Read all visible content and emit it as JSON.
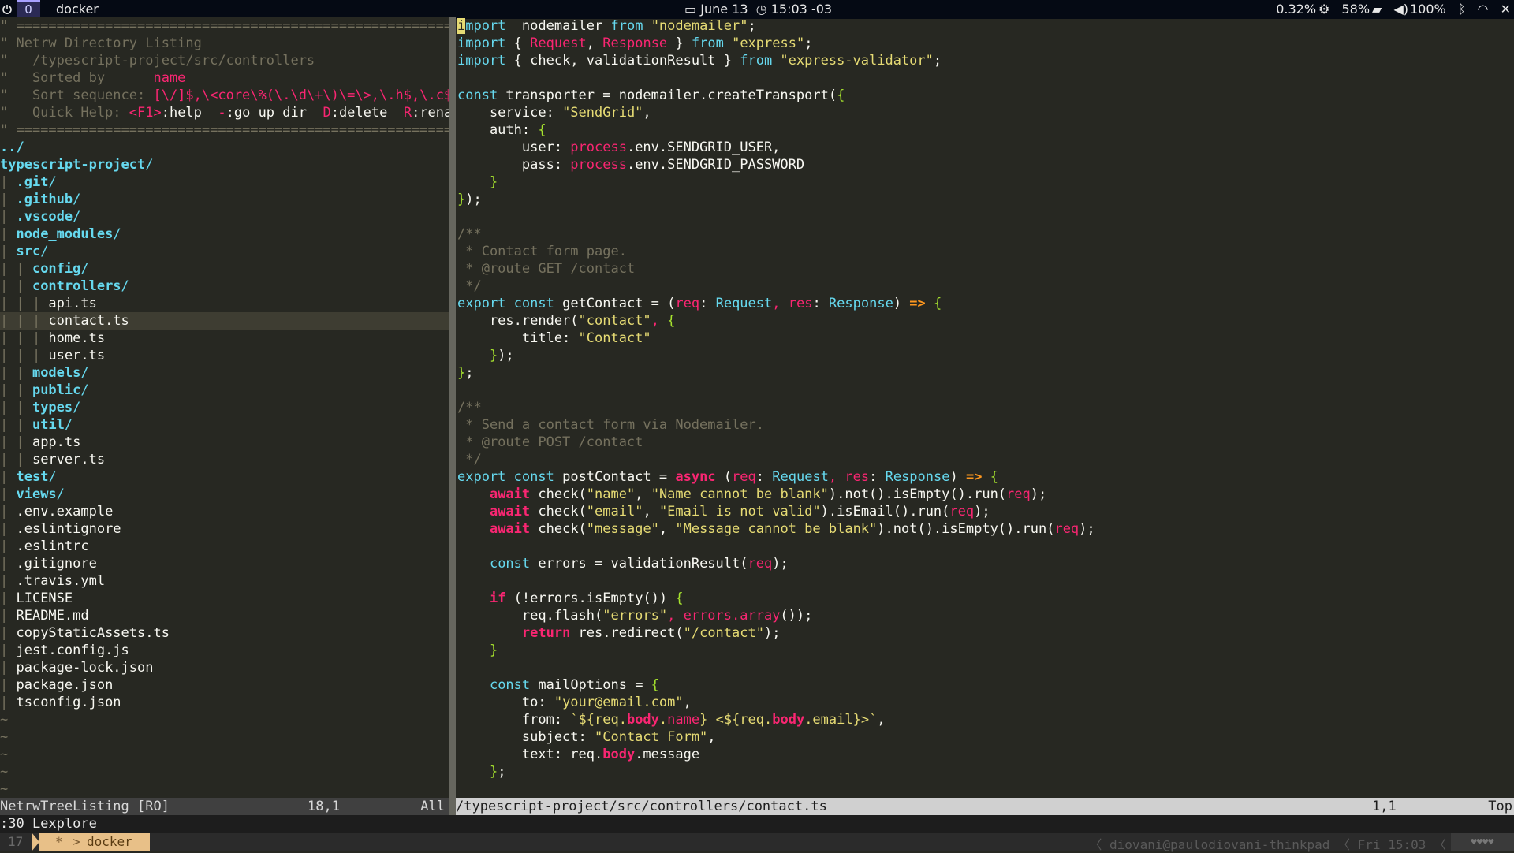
{
  "topbar": {
    "workspace": "0",
    "window_title": "docker",
    "date": "June 13",
    "time": "15:03 -03",
    "cpu": "0.32%",
    "memory": "58%",
    "volume": "100%",
    "icons": [
      "power-icon",
      "calendar-icon",
      "clock-icon",
      "cpu-icon",
      "memory-icon",
      "volume-icon",
      "bluetooth-icon",
      "wifi-icon",
      "bell-off-icon"
    ]
  },
  "netrw": {
    "header": [
      "\" ============================================================================",
      "\" Netrw Directory Listing",
      "\"   /typescript-project/src/controllers",
      "\"   Sorted by      ",
      "\"   Sort sequence: ",
      "\"   Quick Help: ",
      "\" ============================================================================"
    ],
    "sorted_by_value": "name",
    "sort_sequence_value": "[\\/]$,\\<core\\%(\\.\\d\\+\\)\\=\\>,\\.h$,\\.c$,",
    "quick_help_items": [
      "<F1>",
      ":help  ",
      "-",
      ":go up dir  ",
      "D",
      ":delete  ",
      "R",
      ":renam"
    ],
    "tree": [
      {
        "prefix": "",
        "name": "../",
        "dir": true
      },
      {
        "prefix": "",
        "name": "typescript-project",
        "dir": true
      },
      {
        "prefix": "| ",
        "name": ".git",
        "dir": true
      },
      {
        "prefix": "| ",
        "name": ".github",
        "dir": true
      },
      {
        "prefix": "| ",
        "name": ".vscode",
        "dir": true
      },
      {
        "prefix": "| ",
        "name": "node_modules",
        "dir": true
      },
      {
        "prefix": "| ",
        "name": "src",
        "dir": true
      },
      {
        "prefix": "| | ",
        "name": "config",
        "dir": true
      },
      {
        "prefix": "| | ",
        "name": "controllers",
        "dir": true
      },
      {
        "prefix": "| | | ",
        "name": "api.ts",
        "dir": false
      },
      {
        "prefix": "| | | ",
        "name": "contact.ts",
        "dir": false,
        "current": true
      },
      {
        "prefix": "| | | ",
        "name": "home.ts",
        "dir": false
      },
      {
        "prefix": "| | | ",
        "name": "user.ts",
        "dir": false
      },
      {
        "prefix": "| | ",
        "name": "models",
        "dir": true
      },
      {
        "prefix": "| | ",
        "name": "public",
        "dir": true
      },
      {
        "prefix": "| | ",
        "name": "types",
        "dir": true
      },
      {
        "prefix": "| | ",
        "name": "util",
        "dir": true
      },
      {
        "prefix": "| | ",
        "name": "app.ts",
        "dir": false
      },
      {
        "prefix": "| | ",
        "name": "server.ts",
        "dir": false
      },
      {
        "prefix": "| ",
        "name": "test",
        "dir": true
      },
      {
        "prefix": "| ",
        "name": "views",
        "dir": true
      },
      {
        "prefix": "| ",
        "name": ".env.example",
        "dir": false
      },
      {
        "prefix": "| ",
        "name": ".eslintignore",
        "dir": false
      },
      {
        "prefix": "| ",
        "name": ".eslintrc",
        "dir": false
      },
      {
        "prefix": "| ",
        "name": ".gitignore",
        "dir": false
      },
      {
        "prefix": "| ",
        "name": ".travis.yml",
        "dir": false
      },
      {
        "prefix": "| ",
        "name": "LICENSE",
        "dir": false
      },
      {
        "prefix": "| ",
        "name": "README.md",
        "dir": false
      },
      {
        "prefix": "| ",
        "name": "copyStaticAssets.ts",
        "dir": false
      },
      {
        "prefix": "| ",
        "name": "jest.config.js",
        "dir": false
      },
      {
        "prefix": "| ",
        "name": "package-lock.json",
        "dir": false
      },
      {
        "prefix": "| ",
        "name": "package.json",
        "dir": false
      },
      {
        "prefix": "| ",
        "name": "tsconfig.json",
        "dir": false
      }
    ],
    "tilde_lines": [
      "~",
      "~",
      "~",
      "~",
      "~"
    ]
  },
  "code": {
    "lines": [
      [
        [
          "cursor",
          "i"
        ],
        [
          "kw",
          "mport"
        ],
        [
          "",
          "  nodemailer "
        ],
        [
          "kw",
          "from"
        ],
        [
          "str",
          " \"nodemailer\""
        ],
        [
          "",
          ";"
        ]
      ],
      [
        [
          "kw",
          "import"
        ],
        [
          "",
          " { "
        ],
        [
          "red",
          "Request"
        ],
        [
          "",
          ", "
        ],
        [
          "red",
          "Response"
        ],
        [
          "",
          " } "
        ],
        [
          "kw",
          "from"
        ],
        [
          "str",
          " \"express\""
        ],
        [
          "",
          ";"
        ]
      ],
      [
        [
          "kw",
          "import"
        ],
        [
          "",
          " { check, validationResult } "
        ],
        [
          "kw",
          "from"
        ],
        [
          "str",
          " \"express-validator\""
        ],
        [
          "",
          ";"
        ]
      ],
      [],
      [
        [
          "kw",
          "const"
        ],
        [
          "",
          " transporter = nodemailer.createTransport("
        ],
        [
          "grn",
          "{"
        ]
      ],
      [
        [
          "",
          "    service: "
        ],
        [
          "str",
          "\"SendGrid\""
        ],
        [
          "",
          ","
        ]
      ],
      [
        [
          "",
          "    auth: "
        ],
        [
          "grn",
          "{"
        ]
      ],
      [
        [
          "",
          "        user: "
        ],
        [
          "red",
          "process"
        ],
        [
          "",
          ".env.SENDGRID_USER,"
        ]
      ],
      [
        [
          "",
          "        pass: "
        ],
        [
          "red",
          "process"
        ],
        [
          "",
          ".env.SENDGRID_PASSWORD"
        ]
      ],
      [
        [
          "grn",
          "    }"
        ]
      ],
      [
        [
          "grn",
          "}"
        ],
        [
          "",
          ");"
        ]
      ],
      [],
      [
        [
          "cm",
          "/**"
        ]
      ],
      [
        [
          "cm",
          " * Contact form page."
        ]
      ],
      [
        [
          "cm",
          " * @route GET /contact"
        ]
      ],
      [
        [
          "cm",
          " */"
        ]
      ],
      [
        [
          "kw",
          "export"
        ],
        [
          "",
          " "
        ],
        [
          "kw",
          "const"
        ],
        [
          "",
          " getContact = ("
        ],
        [
          "red",
          "req"
        ],
        [
          "",
          ": "
        ],
        [
          "ty",
          "Request"
        ],
        [
          "red",
          ", res"
        ],
        [
          "",
          ": "
        ],
        [
          "ty",
          "Response"
        ],
        [
          "",
          ") "
        ],
        [
          "op",
          "=>"
        ],
        [
          "",
          " "
        ],
        [
          "grn",
          "{"
        ]
      ],
      [
        [
          "",
          "    res.render("
        ],
        [
          "str",
          "\"contact\""
        ],
        [
          "red",
          ","
        ],
        [
          "",
          " "
        ],
        [
          "grn",
          "{"
        ]
      ],
      [
        [
          "",
          "        title: "
        ],
        [
          "str",
          "\"Contact\""
        ]
      ],
      [
        [
          "grn",
          "    }"
        ],
        [
          "",
          ");"
        ]
      ],
      [
        [
          "grn",
          "}"
        ],
        [
          "",
          ";"
        ]
      ],
      [],
      [
        [
          "cm",
          "/**"
        ]
      ],
      [
        [
          "cm",
          " * Send a contact form via Nodemailer."
        ]
      ],
      [
        [
          "cm",
          " * @route POST /contact"
        ]
      ],
      [
        [
          "cm",
          " */"
        ]
      ],
      [
        [
          "kw",
          "export"
        ],
        [
          "",
          " "
        ],
        [
          "kw",
          "const"
        ],
        [
          "",
          " postContact = "
        ],
        [
          "kwb",
          "async"
        ],
        [
          "",
          " ("
        ],
        [
          "red",
          "req"
        ],
        [
          "",
          ": "
        ],
        [
          "ty",
          "Request"
        ],
        [
          "red",
          ", res"
        ],
        [
          "",
          ": "
        ],
        [
          "ty",
          "Response"
        ],
        [
          "",
          ") "
        ],
        [
          "op",
          "=>"
        ],
        [
          "",
          " "
        ],
        [
          "grn",
          "{"
        ]
      ],
      [
        [
          "",
          "    "
        ],
        [
          "kwb",
          "await"
        ],
        [
          "",
          " check("
        ],
        [
          "str",
          "\"name\""
        ],
        [
          "",
          ", "
        ],
        [
          "str",
          "\"Name cannot be blank\""
        ],
        [
          "",
          ").not().isEmpty().run("
        ],
        [
          "red",
          "req"
        ],
        [
          "",
          ");"
        ]
      ],
      [
        [
          "",
          "    "
        ],
        [
          "kwb",
          "await"
        ],
        [
          "",
          " check("
        ],
        [
          "str",
          "\"email\""
        ],
        [
          "",
          ", "
        ],
        [
          "str",
          "\"Email is not valid\""
        ],
        [
          "",
          ").isEmail().run("
        ],
        [
          "red",
          "req"
        ],
        [
          "",
          ");"
        ]
      ],
      [
        [
          "",
          "    "
        ],
        [
          "kwb",
          "await"
        ],
        [
          "",
          " check("
        ],
        [
          "str",
          "\"message\""
        ],
        [
          "",
          ", "
        ],
        [
          "str",
          "\"Message cannot be blank\""
        ],
        [
          "",
          ").not().isEmpty().run("
        ],
        [
          "red",
          "req"
        ],
        [
          "",
          ");"
        ]
      ],
      [],
      [
        [
          "",
          "    "
        ],
        [
          "kw",
          "const"
        ],
        [
          "",
          " errors = validationResult("
        ],
        [
          "red",
          "req"
        ],
        [
          "",
          ");"
        ]
      ],
      [],
      [
        [
          "",
          "    "
        ],
        [
          "kwb",
          "if"
        ],
        [
          "",
          " (!errors.isEmpty()) "
        ],
        [
          "grn",
          "{"
        ]
      ],
      [
        [
          "",
          "        req.flash("
        ],
        [
          "str",
          "\"errors\""
        ],
        [
          "red",
          ", errors.array"
        ],
        [
          "",
          "());"
        ]
      ],
      [
        [
          "",
          "        "
        ],
        [
          "kwb",
          "return"
        ],
        [
          "",
          " res.redirect("
        ],
        [
          "str",
          "\"/contact\""
        ],
        [
          "",
          ");"
        ]
      ],
      [
        [
          "grn",
          "    }"
        ]
      ],
      [],
      [
        [
          "",
          "    "
        ],
        [
          "kw",
          "const"
        ],
        [
          "",
          " mailOptions = "
        ],
        [
          "grn",
          "{"
        ]
      ],
      [
        [
          "",
          "        to: "
        ],
        [
          "str",
          "\"your@email.com\""
        ],
        [
          "",
          ","
        ]
      ],
      [
        [
          "",
          "        from: "
        ],
        [
          "str",
          "`${req."
        ],
        [
          "kwb",
          "body"
        ],
        [
          "str",
          "."
        ],
        [
          "red",
          "name"
        ],
        [
          "str",
          "} <${req."
        ],
        [
          "kwb",
          "body"
        ],
        [
          "str",
          ".email}>`"
        ],
        [
          "",
          ","
        ]
      ],
      [
        [
          "",
          "        subject: "
        ],
        [
          "str",
          "\"Contact Form\""
        ],
        [
          "",
          ","
        ]
      ],
      [
        [
          "",
          "        text: req."
        ],
        [
          "kwb",
          "body"
        ],
        [
          "",
          ".message"
        ]
      ],
      [
        [
          "grn",
          "    }"
        ],
        [
          "",
          ";"
        ]
      ]
    ]
  },
  "status_left": {
    "name": "NetrwTreeListing [RO]",
    "pos": "18,1",
    "scroll": "All"
  },
  "status_right": {
    "path": "/typescript-project/src/controllers/contact.ts",
    "pos": "1,1",
    "scroll": "Top"
  },
  "cmdline": ":30 Lexplore",
  "tmux": {
    "session_num": "17",
    "star": "*",
    "window": "docker",
    "right": "〈 diovani@paulodiovani-thinkpad 〈 Fri 15:03 〈",
    "hearts": "♥♥♥♥"
  }
}
